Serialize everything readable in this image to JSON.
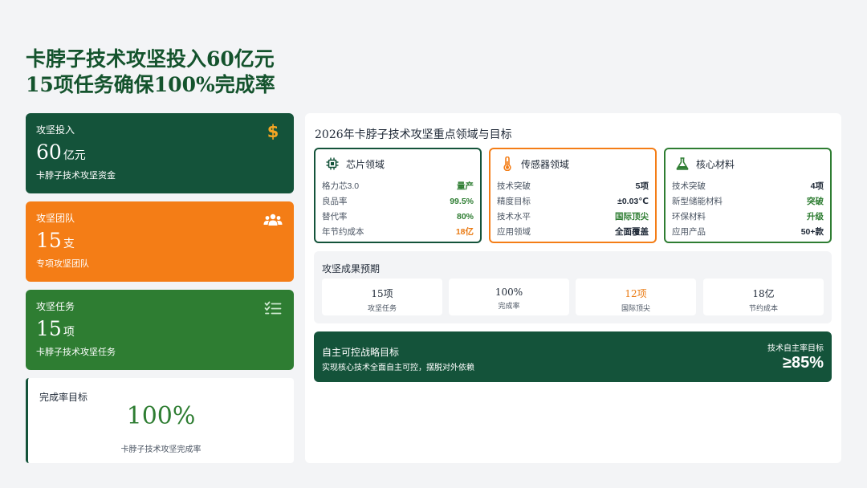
{
  "headline": {
    "line1": "卡脖子技术攻坚投入60亿元",
    "line2": "15项任务确保100%完成率"
  },
  "stats": [
    {
      "label": "攻坚投入",
      "value": "60",
      "unit": "亿元",
      "desc": "卡脖子技术攻坚资金",
      "icon": "dollar-icon",
      "color": "#14533a"
    },
    {
      "label": "攻坚团队",
      "value": "15",
      "unit": "支",
      "desc": "专项攻坚团队",
      "icon": "team-icon",
      "color": "#f47d16"
    },
    {
      "label": "攻坚任务",
      "value": "15",
      "unit": "项",
      "desc": "卡脖子技术攻坚任务",
      "icon": "task-list-icon",
      "color": "#2e7d32"
    }
  ],
  "rate": {
    "label": "完成率目标",
    "value": "100%",
    "desc": "卡脖子技术攻坚完成率"
  },
  "panel": {
    "title": "2026年卡脖子技术攻坚重点领域与目标"
  },
  "domains": [
    {
      "title": "芯片领域",
      "icon": "chip-icon",
      "rows": [
        {
          "k": "格力芯3.0",
          "v": "量产"
        },
        {
          "k": "良品率",
          "v": "99.5%"
        },
        {
          "k": "替代率",
          "v": "80%"
        },
        {
          "k": "年节约成本",
          "v": "18亿"
        }
      ]
    },
    {
      "title": "传感器领域",
      "icon": "thermometer-icon",
      "rows": [
        {
          "k": "技术突破",
          "v": "5项"
        },
        {
          "k": "精度目标",
          "v": "±0.03℃"
        },
        {
          "k": "技术水平",
          "v": "国际顶尖"
        },
        {
          "k": "应用领域",
          "v": "全面覆盖"
        }
      ]
    },
    {
      "title": "核心材料",
      "icon": "flask-icon",
      "rows": [
        {
          "k": "技术突破",
          "v": "4项"
        },
        {
          "k": "新型储能材料",
          "v": "突破"
        },
        {
          "k": "环保材料",
          "v": "升级"
        },
        {
          "k": "应用产品",
          "v": "50+款"
        }
      ]
    }
  ],
  "outcome": {
    "title": "攻坚成果预期",
    "items": [
      {
        "value": "15项",
        "label": "攻坚任务"
      },
      {
        "value": "100%",
        "label": "完成率"
      },
      {
        "value": "12项",
        "label": "国际顶尖"
      },
      {
        "value": "18亿",
        "label": "节约成本"
      }
    ]
  },
  "strategy": {
    "title": "自主可控战略目标",
    "desc": "实现核心技术全面自主可控，摆脱对外依赖",
    "target_label": "技术自主率目标",
    "target_value": "≥85%"
  },
  "colors": {
    "dark_green": "#14533a",
    "orange": "#f47d16",
    "green": "#2e7d32",
    "gold": "#f5a623"
  }
}
